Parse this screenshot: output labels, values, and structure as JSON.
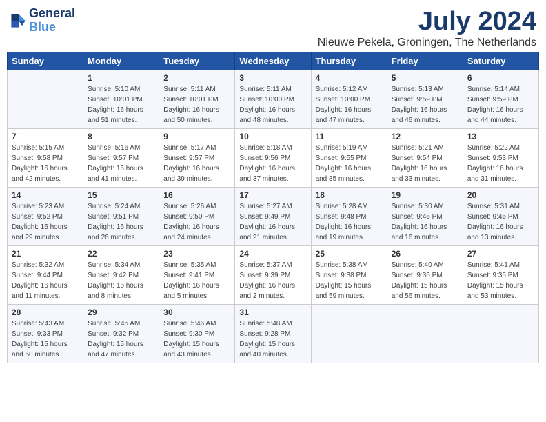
{
  "header": {
    "logo_line1": "General",
    "logo_line2": "Blue",
    "month_year": "July 2024",
    "location": "Nieuwe Pekela, Groningen, The Netherlands"
  },
  "days_of_week": [
    "Sunday",
    "Monday",
    "Tuesday",
    "Wednesday",
    "Thursday",
    "Friday",
    "Saturday"
  ],
  "weeks": [
    [
      {
        "day": "",
        "info": ""
      },
      {
        "day": "1",
        "info": "Sunrise: 5:10 AM\nSunset: 10:01 PM\nDaylight: 16 hours\nand 51 minutes."
      },
      {
        "day": "2",
        "info": "Sunrise: 5:11 AM\nSunset: 10:01 PM\nDaylight: 16 hours\nand 50 minutes."
      },
      {
        "day": "3",
        "info": "Sunrise: 5:11 AM\nSunset: 10:00 PM\nDaylight: 16 hours\nand 48 minutes."
      },
      {
        "day": "4",
        "info": "Sunrise: 5:12 AM\nSunset: 10:00 PM\nDaylight: 16 hours\nand 47 minutes."
      },
      {
        "day": "5",
        "info": "Sunrise: 5:13 AM\nSunset: 9:59 PM\nDaylight: 16 hours\nand 46 minutes."
      },
      {
        "day": "6",
        "info": "Sunrise: 5:14 AM\nSunset: 9:59 PM\nDaylight: 16 hours\nand 44 minutes."
      }
    ],
    [
      {
        "day": "7",
        "info": "Sunrise: 5:15 AM\nSunset: 9:58 PM\nDaylight: 16 hours\nand 42 minutes."
      },
      {
        "day": "8",
        "info": "Sunrise: 5:16 AM\nSunset: 9:57 PM\nDaylight: 16 hours\nand 41 minutes."
      },
      {
        "day": "9",
        "info": "Sunrise: 5:17 AM\nSunset: 9:57 PM\nDaylight: 16 hours\nand 39 minutes."
      },
      {
        "day": "10",
        "info": "Sunrise: 5:18 AM\nSunset: 9:56 PM\nDaylight: 16 hours\nand 37 minutes."
      },
      {
        "day": "11",
        "info": "Sunrise: 5:19 AM\nSunset: 9:55 PM\nDaylight: 16 hours\nand 35 minutes."
      },
      {
        "day": "12",
        "info": "Sunrise: 5:21 AM\nSunset: 9:54 PM\nDaylight: 16 hours\nand 33 minutes."
      },
      {
        "day": "13",
        "info": "Sunrise: 5:22 AM\nSunset: 9:53 PM\nDaylight: 16 hours\nand 31 minutes."
      }
    ],
    [
      {
        "day": "14",
        "info": "Sunrise: 5:23 AM\nSunset: 9:52 PM\nDaylight: 16 hours\nand 29 minutes."
      },
      {
        "day": "15",
        "info": "Sunrise: 5:24 AM\nSunset: 9:51 PM\nDaylight: 16 hours\nand 26 minutes."
      },
      {
        "day": "16",
        "info": "Sunrise: 5:26 AM\nSunset: 9:50 PM\nDaylight: 16 hours\nand 24 minutes."
      },
      {
        "day": "17",
        "info": "Sunrise: 5:27 AM\nSunset: 9:49 PM\nDaylight: 16 hours\nand 21 minutes."
      },
      {
        "day": "18",
        "info": "Sunrise: 5:28 AM\nSunset: 9:48 PM\nDaylight: 16 hours\nand 19 minutes."
      },
      {
        "day": "19",
        "info": "Sunrise: 5:30 AM\nSunset: 9:46 PM\nDaylight: 16 hours\nand 16 minutes."
      },
      {
        "day": "20",
        "info": "Sunrise: 5:31 AM\nSunset: 9:45 PM\nDaylight: 16 hours\nand 13 minutes."
      }
    ],
    [
      {
        "day": "21",
        "info": "Sunrise: 5:32 AM\nSunset: 9:44 PM\nDaylight: 16 hours\nand 11 minutes."
      },
      {
        "day": "22",
        "info": "Sunrise: 5:34 AM\nSunset: 9:42 PM\nDaylight: 16 hours\nand 8 minutes."
      },
      {
        "day": "23",
        "info": "Sunrise: 5:35 AM\nSunset: 9:41 PM\nDaylight: 16 hours\nand 5 minutes."
      },
      {
        "day": "24",
        "info": "Sunrise: 5:37 AM\nSunset: 9:39 PM\nDaylight: 16 hours\nand 2 minutes."
      },
      {
        "day": "25",
        "info": "Sunrise: 5:38 AM\nSunset: 9:38 PM\nDaylight: 15 hours\nand 59 minutes."
      },
      {
        "day": "26",
        "info": "Sunrise: 5:40 AM\nSunset: 9:36 PM\nDaylight: 15 hours\nand 56 minutes."
      },
      {
        "day": "27",
        "info": "Sunrise: 5:41 AM\nSunset: 9:35 PM\nDaylight: 15 hours\nand 53 minutes."
      }
    ],
    [
      {
        "day": "28",
        "info": "Sunrise: 5:43 AM\nSunset: 9:33 PM\nDaylight: 15 hours\nand 50 minutes."
      },
      {
        "day": "29",
        "info": "Sunrise: 5:45 AM\nSunset: 9:32 PM\nDaylight: 15 hours\nand 47 minutes."
      },
      {
        "day": "30",
        "info": "Sunrise: 5:46 AM\nSunset: 9:30 PM\nDaylight: 15 hours\nand 43 minutes."
      },
      {
        "day": "31",
        "info": "Sunrise: 5:48 AM\nSunset: 9:28 PM\nDaylight: 15 hours\nand 40 minutes."
      },
      {
        "day": "",
        "info": ""
      },
      {
        "day": "",
        "info": ""
      },
      {
        "day": "",
        "info": ""
      }
    ]
  ]
}
